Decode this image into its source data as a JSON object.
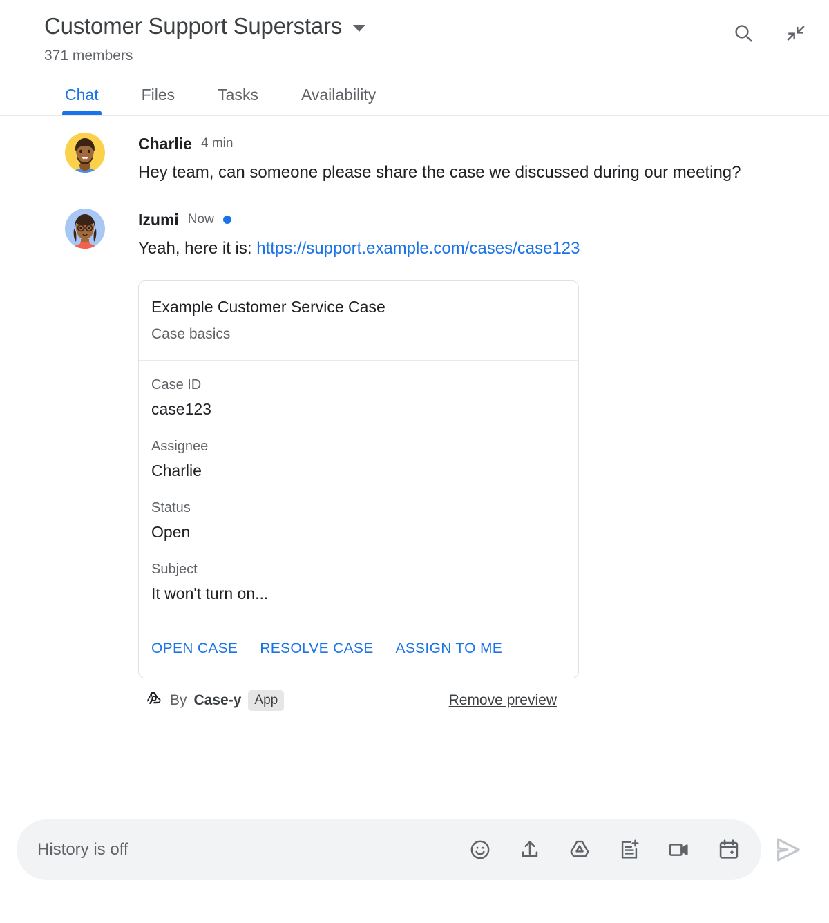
{
  "header": {
    "room_title": "Customer Support Superstars",
    "member_count": "371 members",
    "dropdown_icon": "chevron-down-icon",
    "actions": [
      {
        "name": "search-icon",
        "label": "Search"
      },
      {
        "name": "collapse-icon",
        "label": "Collapse"
      }
    ]
  },
  "tabs": [
    {
      "label": "Chat",
      "active": true
    },
    {
      "label": "Files",
      "active": false
    },
    {
      "label": "Tasks",
      "active": false
    },
    {
      "label": "Availability",
      "active": false
    }
  ],
  "messages": [
    {
      "sender": "Charlie",
      "timestamp": "4 min",
      "unread": false,
      "text": "Hey team, can someone please share the case we discussed during our meeting?"
    },
    {
      "sender": "Izumi",
      "timestamp": "Now",
      "unread": true,
      "text_prefix": "Yeah, here it is: ",
      "link_text": "https://support.example.com/cases/case123"
    }
  ],
  "card": {
    "title": "Example Customer Service Case",
    "subtitle": "Case basics",
    "fields": [
      {
        "label": "Case ID",
        "value": "case123"
      },
      {
        "label": "Assignee",
        "value": "Charlie"
      },
      {
        "label": "Status",
        "value": "Open"
      },
      {
        "label": "Subject",
        "value": "It won't turn on..."
      }
    ],
    "actions": [
      "OPEN CASE",
      "RESOLVE CASE",
      "ASSIGN TO ME"
    ]
  },
  "attribution": {
    "app_icon": "webhook-icon",
    "by_text": "By",
    "app_name": "Case-y",
    "badge": "App",
    "remove_preview": "Remove preview"
  },
  "composer": {
    "placeholder": "History is off",
    "icons": [
      {
        "name": "emoji-icon",
        "label": "Insert emoji"
      },
      {
        "name": "upload-icon",
        "label": "Upload file"
      },
      {
        "name": "drive-icon",
        "label": "Add from Drive"
      },
      {
        "name": "create-doc-icon",
        "label": "Create new document"
      },
      {
        "name": "video-icon",
        "label": "Add video meeting"
      },
      {
        "name": "calendar-icon",
        "label": "Create event"
      }
    ],
    "send_icon": "send-icon"
  },
  "colors": {
    "accent": "#1a73e8",
    "text": "#202124",
    "muted": "#5f6368",
    "border": "#e0e0e0",
    "composer_bg": "#f1f3f4"
  }
}
